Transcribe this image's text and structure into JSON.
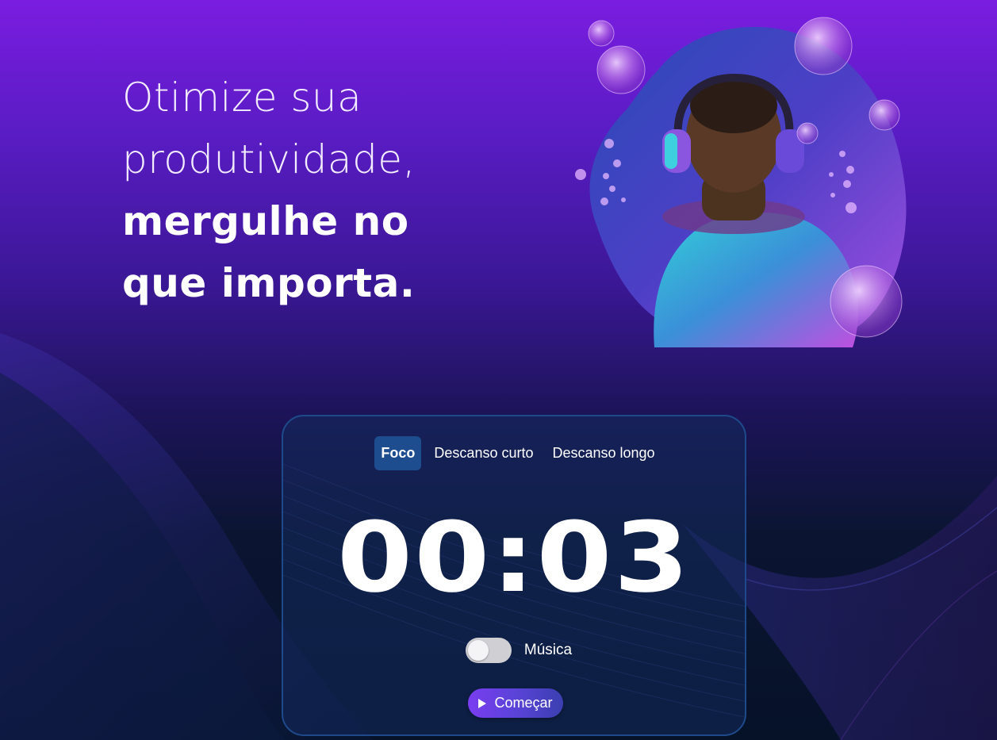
{
  "hero": {
    "title_light_line1": "Otimize sua",
    "title_light_line2": "produtividade,",
    "title_bold_line1": "mergulhe no",
    "title_bold_line2": "que importa.",
    "image": "headphones-diver-illustration"
  },
  "timer": {
    "tabs": [
      {
        "label": "Foco",
        "active": true
      },
      {
        "label": "Descanso curto",
        "active": false
      },
      {
        "label": "Descanso longo",
        "active": false
      }
    ],
    "display": "00:03",
    "music_label": "Música",
    "music_enabled": false,
    "start_label": "Começar",
    "start_icon": "play-icon"
  },
  "colors": {
    "gradient_top": "#7a1de0",
    "gradient_bottom": "#061228",
    "active_tab": "#1d4c8f",
    "card_border": "#1e4a8c",
    "button_start": "#7a3df0",
    "button_end": "#3b3fb0"
  }
}
